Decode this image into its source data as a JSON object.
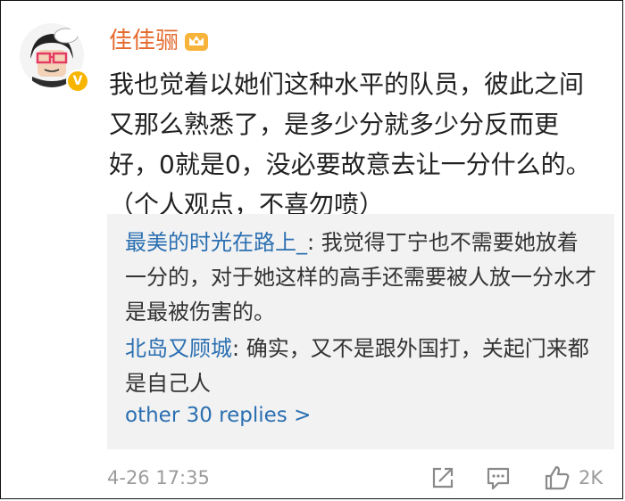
{
  "post": {
    "username": "佳佳骊",
    "text": "我也觉着以她们这种水平的队员，彼此之间\n又那么熟悉了，是多少分就多少分反而更\n好，0就是0，没必要故意去让一分什么的。\n（个人观点，不喜勿喷）"
  },
  "replies": [
    {
      "author": "最美的时光在路上_",
      "text": "我觉得丁宁也不需要她放着一分的，对于她这样的高手还需要被人放一分水才是最被伤害的。"
    },
    {
      "author": "北岛又顾城",
      "text": "确实，又不是跟外国打，关起门来都是自己人"
    }
  ],
  "more_replies_label": "other 30 replies >",
  "footer": {
    "timestamp": "4-26 17:35",
    "like_count": "2K"
  },
  "icons": [
    "avatar-image",
    "verified-badge-icon",
    "crown-icon",
    "share-icon",
    "comment-icon",
    "like-icon"
  ],
  "colors": {
    "username": "#e46b2f",
    "link": "#2a6fb1",
    "meta": "#9b9b9b",
    "reply_bg": "#f2f2f2"
  }
}
